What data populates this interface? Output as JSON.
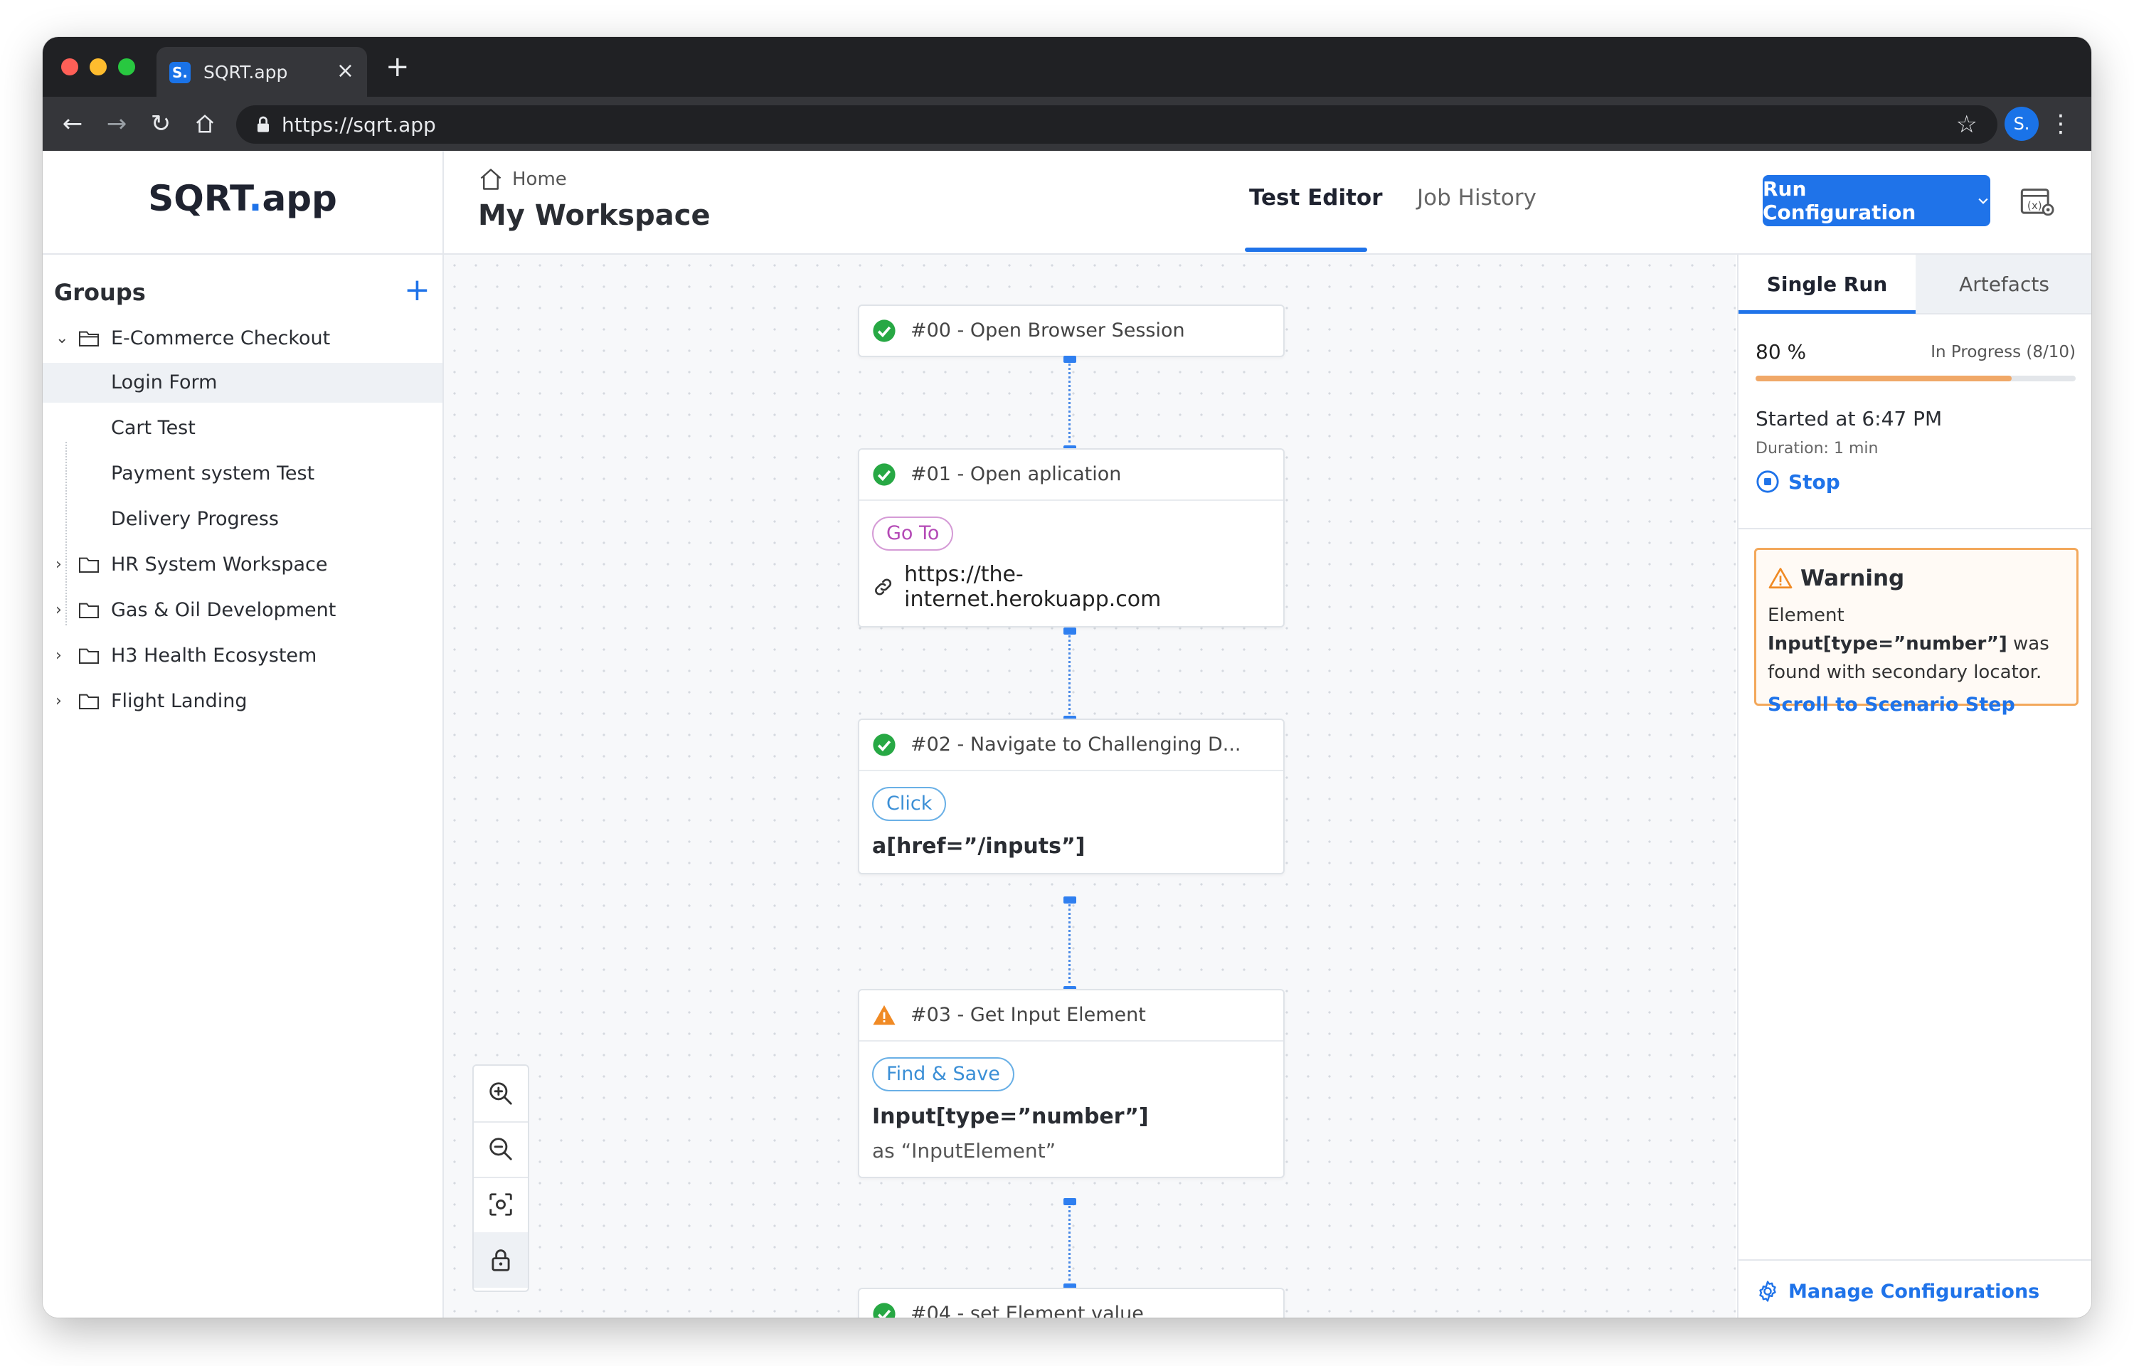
{
  "browser": {
    "tab_title": "SQRT.app",
    "favicon_letter": "S.",
    "url": "https://sqrt.app",
    "profile_initial": "S."
  },
  "app": {
    "logo_main": "SQRT",
    "logo_dot": ".",
    "logo_suffix": "app"
  },
  "header": {
    "breadcrumb": "Home",
    "page_title": "My Workspace",
    "tabs": [
      {
        "label": "Test Editor",
        "active": true
      },
      {
        "label": "Job History",
        "active": false
      }
    ],
    "run_button": "Run Configuration"
  },
  "sidebar": {
    "title": "Groups",
    "tree": [
      {
        "label": "E-Commerce Checkout",
        "expanded": true
      },
      {
        "label": "Login Form",
        "selected": true
      },
      {
        "label": "Cart Test"
      },
      {
        "label": "Payment system Test"
      },
      {
        "label": "Delivery Progress"
      },
      {
        "label": "HR System Workspace",
        "expanded": false
      },
      {
        "label": "Gas & Oil Development",
        "expanded": false
      },
      {
        "label": "H3 Health Ecosystem",
        "expanded": false
      },
      {
        "label": "Flight Landing",
        "expanded": false
      }
    ]
  },
  "steps": [
    {
      "title": "#00 - Open Browser Session",
      "status": "success"
    },
    {
      "title": "#01 - Open aplication",
      "status": "success",
      "action": "Go To",
      "url": "https://the-internet.herokuapp.com"
    },
    {
      "title": "#02 - Navigate to Challenging D...",
      "status": "success",
      "action": "Click",
      "selector": "a[href=”/inputs”]"
    },
    {
      "title": "#03 - Get Input Element",
      "status": "warning",
      "action": "Find & Save",
      "selector": "Input[type=”number”]",
      "alias": "as “InputElement”"
    },
    {
      "title": "#04 - set Element value",
      "status": "success"
    }
  ],
  "run_panel": {
    "tabs": [
      "Single Run",
      "Artefacts"
    ],
    "progress_percent_label": "80 %",
    "progress_fraction": 0.8,
    "progress_state": "In Progress (8/10)",
    "started": "Started at 6:47 PM",
    "duration": "Duration: 1 min",
    "stop_label": "Stop",
    "warning": {
      "title": "Warning",
      "text_pre": "Element ",
      "element": "Input[type=”number”]",
      "text_post": " was found with secondary locator.",
      "link": "Scroll to Scenario Step"
    },
    "manage_label": "Manage Configurations"
  },
  "colors": {
    "accent": "#1f73e9",
    "success": "#27a844",
    "warning": "#f08a24",
    "progress": "#f0a868"
  }
}
